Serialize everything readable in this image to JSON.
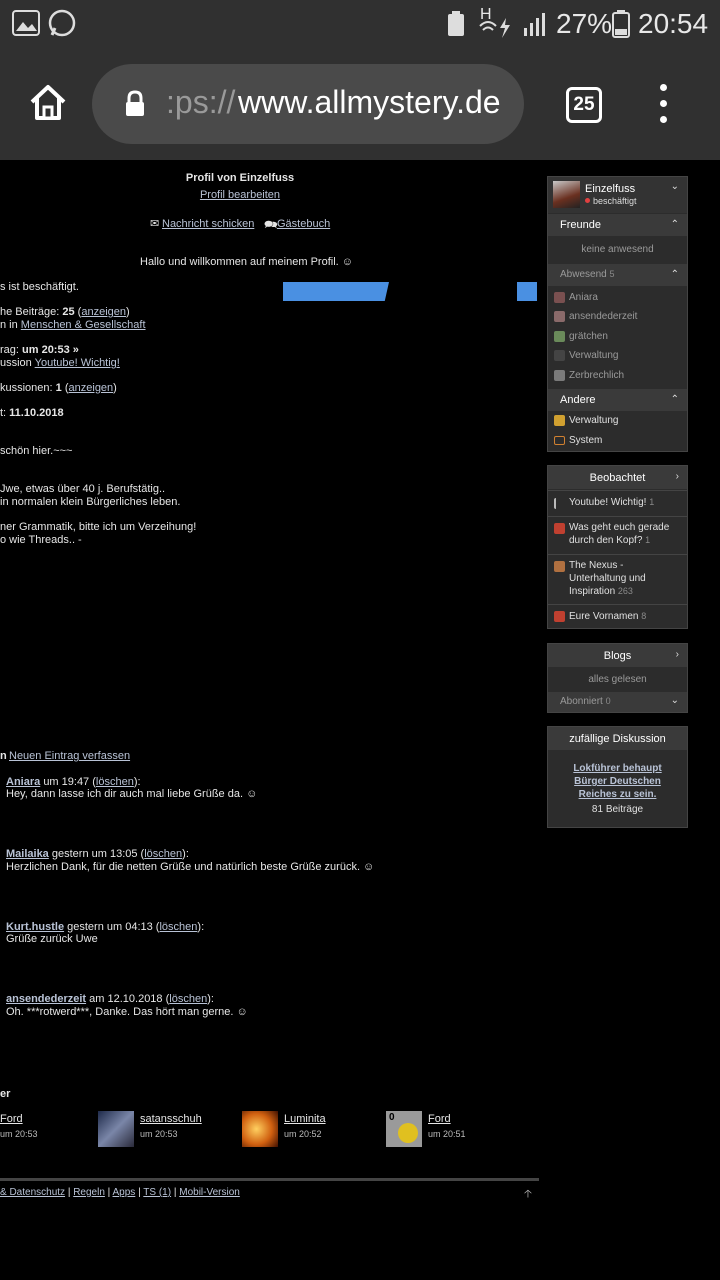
{
  "status_bar": {
    "battery": "27%",
    "time": "20:54",
    "signal": "H"
  },
  "browser": {
    "url_scheme": ":ps://",
    "url_host": "www.allmystery.de",
    "tab_count": "25"
  },
  "profile": {
    "title": "Profil von Einzelfuss",
    "edit_link": "Profil bearbeiten",
    "send_message": "Nachricht schicken",
    "guestbook": "Gästebuch",
    "welcome": "Hallo und willkommen auf meinem Profil. ☺",
    "status_line": "s ist beschäftigt.",
    "posts_prefix": "he Beiträge: ",
    "posts_count": "25",
    "posts_link": "anzeigen",
    "posts_in": "n in ",
    "posts_category": "Menschen & Gesellschaft",
    "last_prefix": "rag: ",
    "last_time": "um 20:53 »",
    "last_disc_prefix": "ussion ",
    "last_disc": "Youtube! Wichtig!",
    "discussions_prefix": "kussionen: ",
    "discussions_count": "1",
    "discussions_link": "anzeigen",
    "since_prefix": "t: ",
    "since_date": "11.10.2018",
    "about": [
      "schön hier.~~~",
      "Jwe, etwas über 40 j. Berufstätig..",
      "in normalen klein Bürgerliches leben.",
      "ner Grammatik, bitte ich um Verzeihung!",
      "o wie Threads.. -"
    ]
  },
  "guestbook": {
    "label_fragment": "n",
    "new_entry": "Neuen Eintrag verfassen",
    "delete_label": "löschen",
    "entries": [
      {
        "author": "Aniara",
        "when": "um 19:47",
        "text": "Hey, dann lasse ich dir auch mal liebe Grüße da. ☺"
      },
      {
        "author": "Mailaika",
        "when": "gestern um 13:05",
        "text": "Herzlichen Dank, für die netten Grüße und natürlich beste Grüße zurück. ☺"
      },
      {
        "author": "Kurt.hustle",
        "when": "gestern um 04:13",
        "text": "Grüße zurück Uwe"
      },
      {
        "author": "ansendederzeit",
        "when": "am 12.10.2018",
        "text": "Oh. ***rotwerd***, Danke. Das hört man gerne. ☺"
      }
    ]
  },
  "visitors": {
    "label_fragment": "er",
    "items": [
      {
        "name": "Ford",
        "time": "um 20:53",
        "badge": ""
      },
      {
        "name": "satansschuh",
        "time": "um 20:53",
        "badge": ""
      },
      {
        "name": "Luminita",
        "time": "um 20:52",
        "badge": ""
      },
      {
        "name": "Ford",
        "time": "um 20:51",
        "badge": "0"
      }
    ]
  },
  "footer": {
    "links": [
      "& Datenschutz",
      "Regeln",
      "Apps",
      "TS (1)",
      "Mobil-Version"
    ]
  },
  "sidebar": {
    "user": {
      "name": "Einzelfuss",
      "status": "beschäftigt"
    },
    "friends": {
      "header": "Freunde",
      "online_none": "keine anwesend",
      "away_header": "Abwesend",
      "away_count": "5",
      "away": [
        "Aniara",
        "ansendederzeit",
        "grätchen",
        "Verwaltung",
        "Zerbrechlich"
      ],
      "other_header": "Andere",
      "other": [
        "Verwaltung",
        "System"
      ]
    },
    "watched": {
      "header": "Beobachtet",
      "items": [
        {
          "title": "Youtube! Wichtig!",
          "count": "1"
        },
        {
          "title": "Was geht euch gerade durch den Kopf?",
          "count": "1"
        },
        {
          "title": "The Nexus - Unterhaltung und Inspiration",
          "count": "263"
        },
        {
          "title": "Eure Vornamen",
          "count": "8"
        }
      ]
    },
    "blogs": {
      "header": "Blogs",
      "status": "alles gelesen",
      "subscribed": "Abonniert",
      "subscribed_count": "0"
    },
    "random": {
      "header": "zufällige Diskussion",
      "title": "Lokführer behaupt Bürger Deutschen Reiches zu sein.",
      "posts": "81 Beiträge"
    }
  },
  "colors": {
    "accent_blue": "#4a90e2",
    "status_busy": "#e04040",
    "panel_bg": "#2c2c2c"
  }
}
